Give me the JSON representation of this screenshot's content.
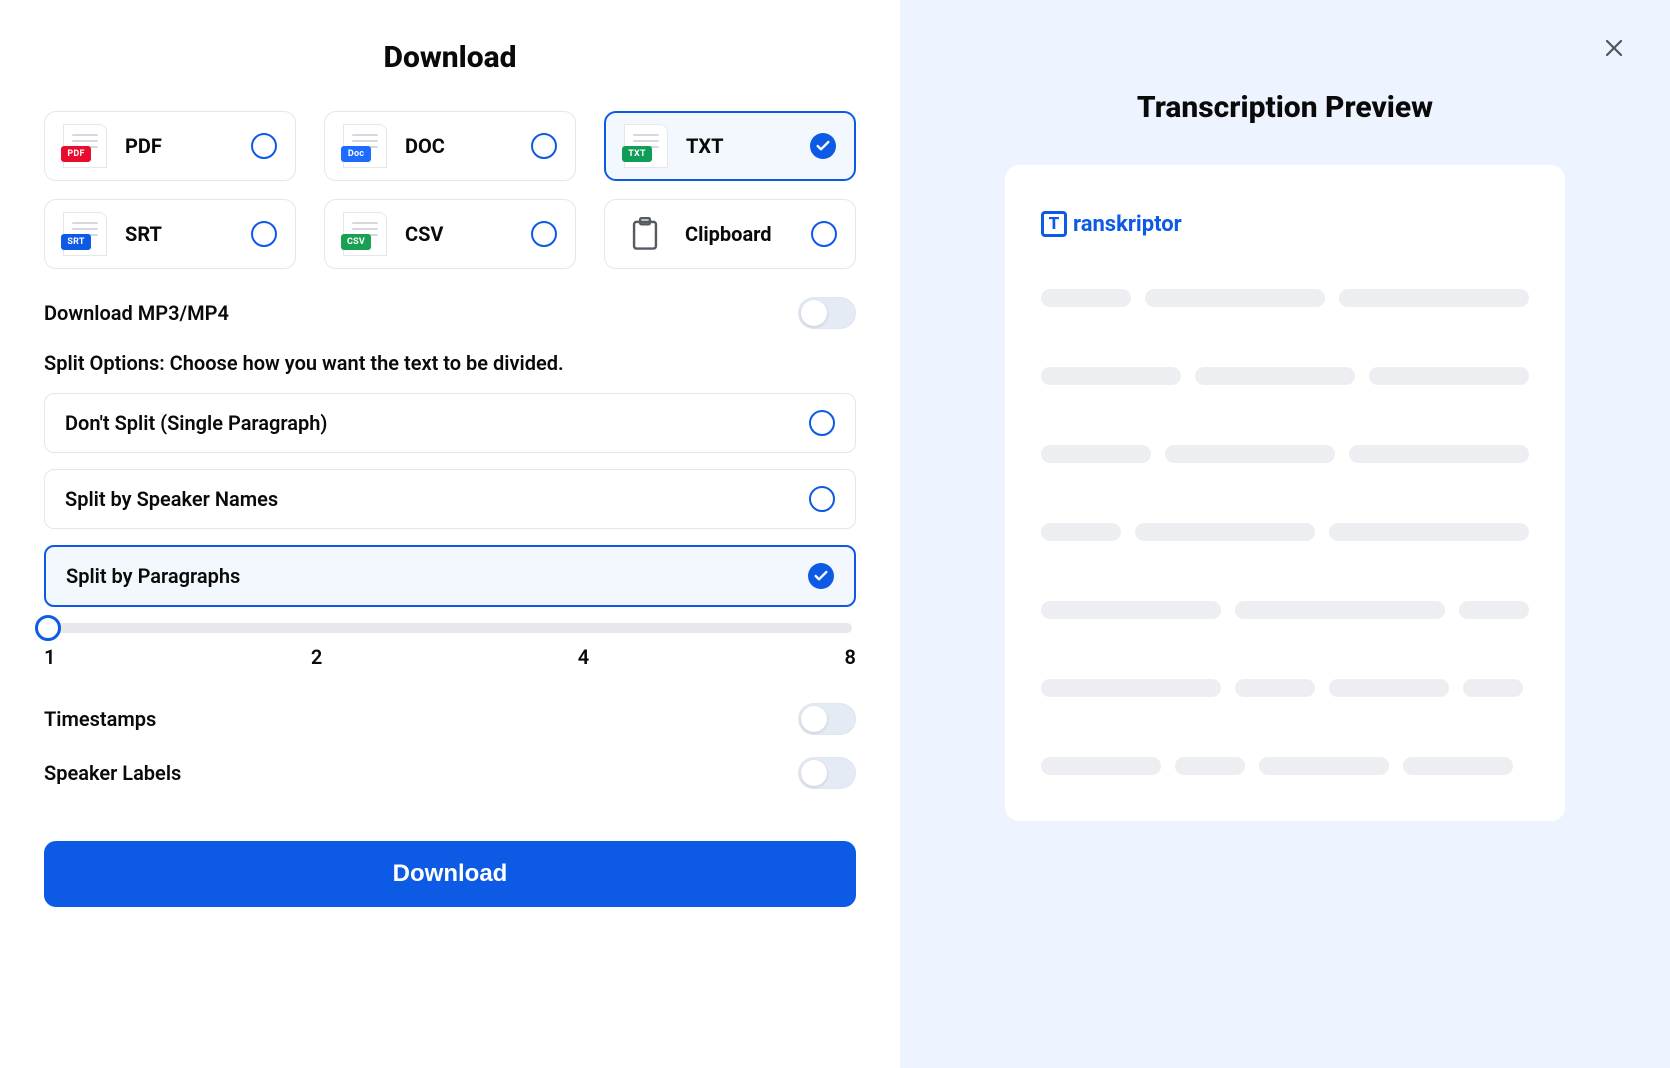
{
  "title": "Download",
  "formats": {
    "pdf": {
      "label": "PDF",
      "badge": "PDF"
    },
    "doc": {
      "label": "DOC",
      "badge": "Doc"
    },
    "txt": {
      "label": "TXT",
      "badge": "TXT"
    },
    "srt": {
      "label": "SRT",
      "badge": "SRT"
    },
    "csv": {
      "label": "CSV",
      "badge": "CSV"
    },
    "clip": {
      "label": "Clipboard"
    }
  },
  "selected_format": "txt",
  "mp3_label": "Download MP3/MP4",
  "mp3_enabled": false,
  "split_heading": "Split Options: Choose how you want the text to be divided.",
  "split_options": {
    "none": {
      "label": "Don't Split (Single Paragraph)"
    },
    "spk": {
      "label": "Split by Speaker Names"
    },
    "para": {
      "label": "Split by Paragraphs"
    }
  },
  "selected_split": "para",
  "slider": {
    "value": 1,
    "ticks": {
      "t1": "1",
      "t2": "2",
      "t4": "4",
      "t8": "8"
    }
  },
  "toggles": {
    "timestamps": {
      "label": "Timestamps",
      "on": false
    },
    "speakers": {
      "label": "Speaker Labels",
      "on": false
    }
  },
  "download_button": "Download",
  "preview": {
    "title": "Transcription Preview",
    "brand": "ranskriptor",
    "brand_initial": "T"
  }
}
